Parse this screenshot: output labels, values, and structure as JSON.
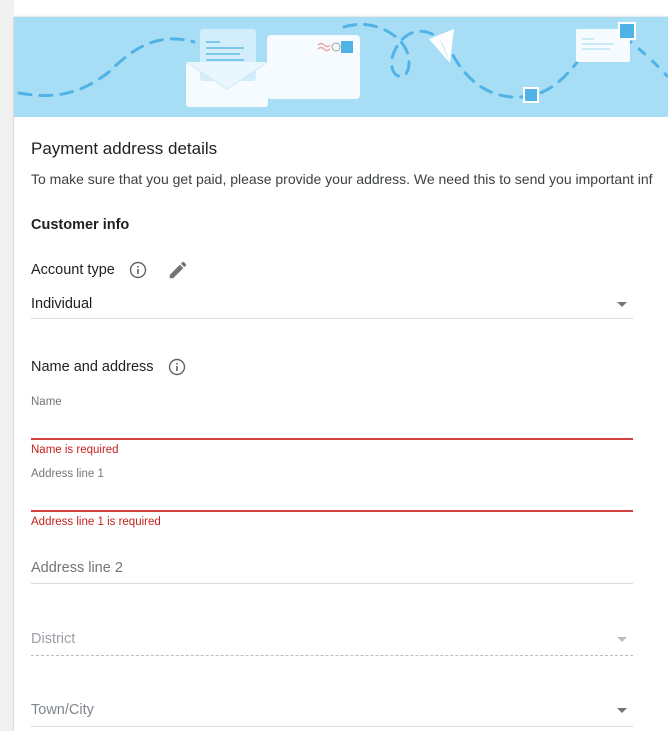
{
  "header": {
    "title": "Payment address details",
    "description": "To make sure that you get paid, please provide your address. We need this to send you important inf"
  },
  "customer_info": {
    "heading": "Customer info",
    "account_type_label": "Account type",
    "account_type_value": "Individual"
  },
  "name_address": {
    "heading": "Name and address",
    "name_label": "Name",
    "name_value": "",
    "name_error": "Name is required",
    "address1_label": "Address line 1",
    "address1_value": "",
    "address1_error": "Address line 1 is required",
    "address2_placeholder": "Address line 2",
    "district_placeholder": "District",
    "town_placeholder": "Town/City"
  },
  "colors": {
    "banner_bg": "#a7def6",
    "error": "#c5221f",
    "accent_blue": "#4fb3e8"
  },
  "icons": [
    "info-icon",
    "pencil-icon",
    "chevron-down-icon",
    "envelope-icon",
    "paper-plane-icon"
  ]
}
